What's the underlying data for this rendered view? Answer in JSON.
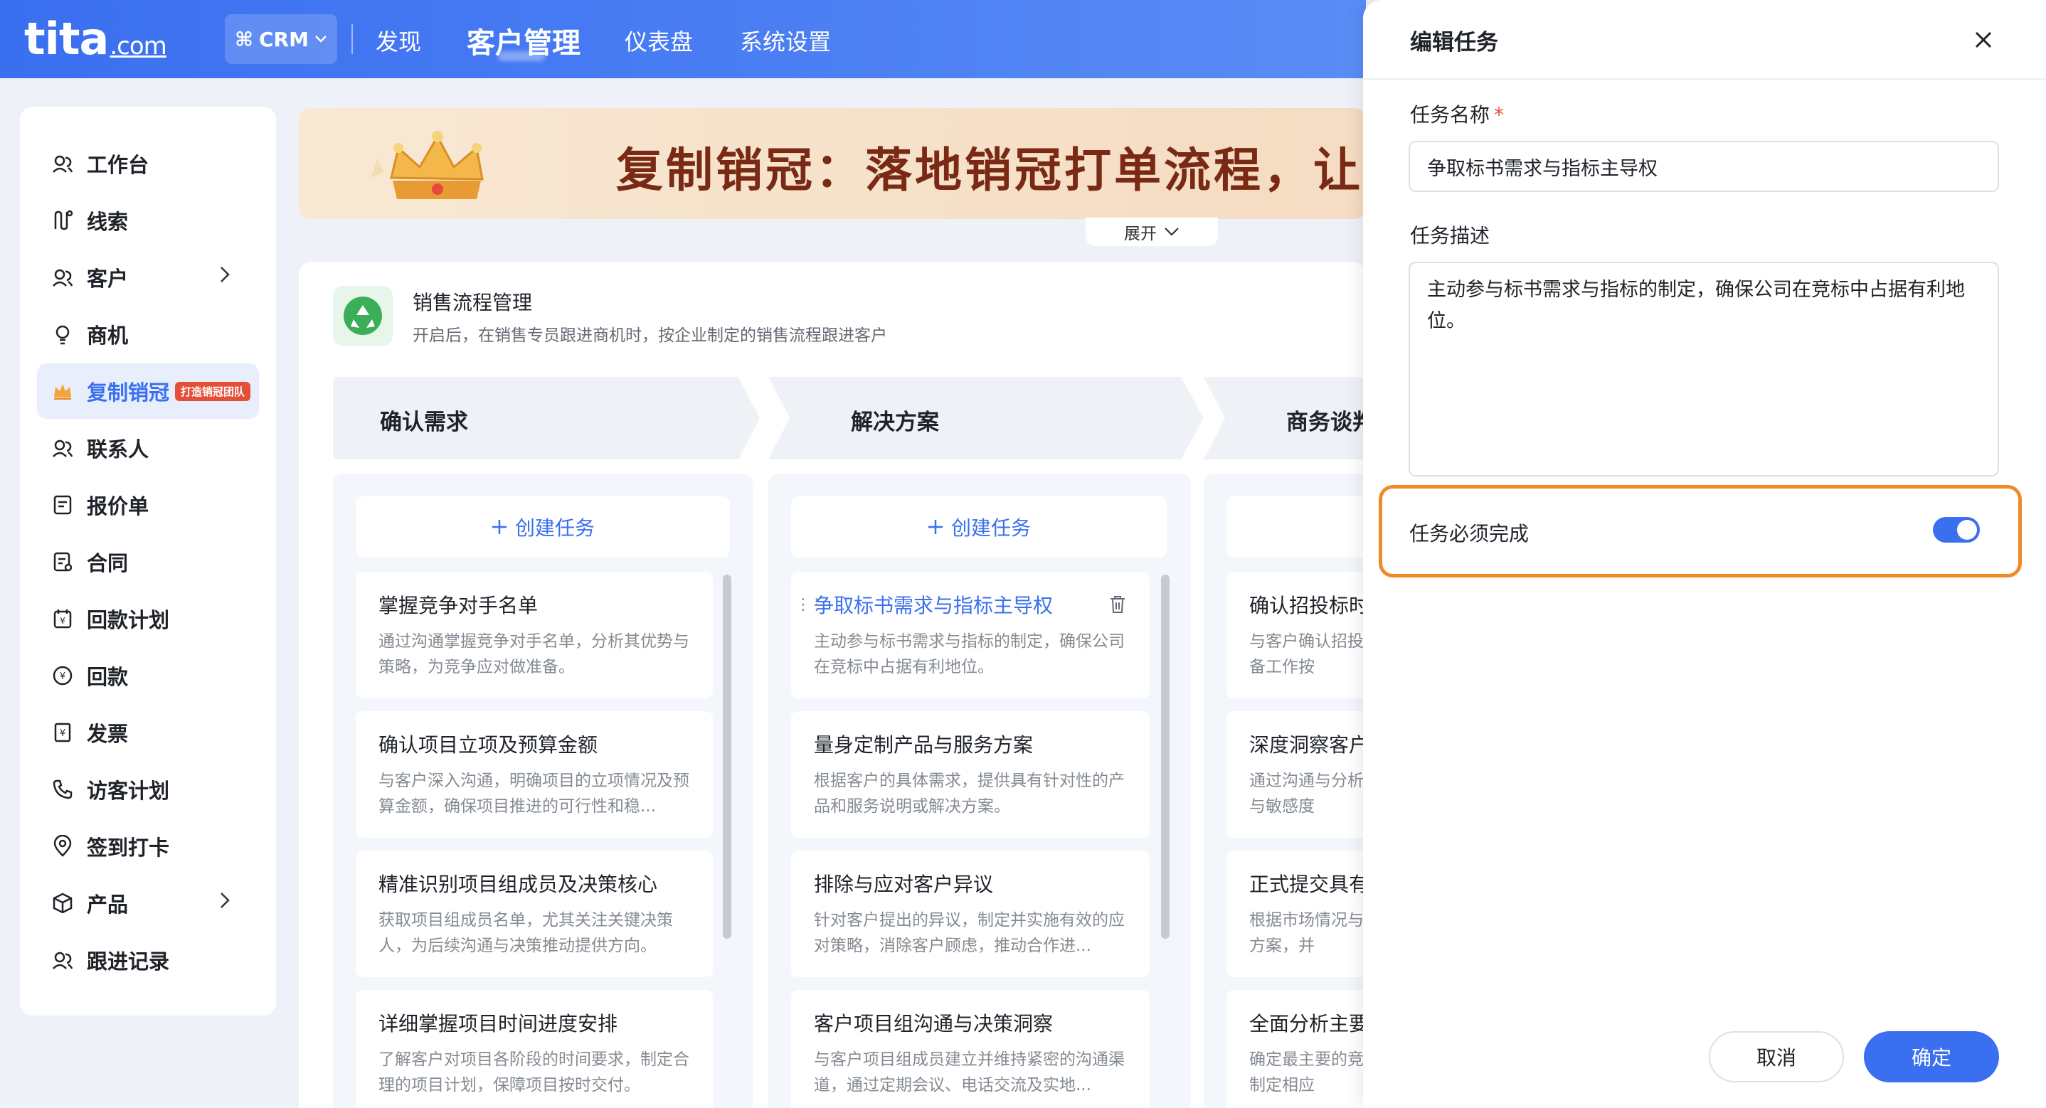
{
  "header": {
    "logo_main": "tita",
    "logo_suffix": ".com",
    "crm_label": "CRM",
    "nav": [
      "发现",
      "客户管理",
      "仪表盘",
      "系统设置"
    ],
    "active_nav": "客户管理"
  },
  "sidebar": {
    "items": [
      {
        "label": "工作台",
        "icon": "workbench-icon"
      },
      {
        "label": "线索",
        "icon": "leads-icon"
      },
      {
        "label": "客户",
        "icon": "customer-icon",
        "has_submenu": true
      },
      {
        "label": "商机",
        "icon": "opportunity-icon"
      },
      {
        "label": "复制销冠",
        "icon": "crown-icon",
        "badge": "打造销冠团队",
        "active": true
      },
      {
        "label": "联系人",
        "icon": "contacts-icon"
      },
      {
        "label": "报价单",
        "icon": "quote-icon"
      },
      {
        "label": "合同",
        "icon": "contract-icon"
      },
      {
        "label": "回款计划",
        "icon": "payment-plan-icon"
      },
      {
        "label": "回款",
        "icon": "payment-icon"
      },
      {
        "label": "发票",
        "icon": "invoice-icon"
      },
      {
        "label": "访客计划",
        "icon": "visit-plan-icon"
      },
      {
        "label": "签到打卡",
        "icon": "checkin-icon"
      },
      {
        "label": "产品",
        "icon": "product-icon",
        "has_submenu": true
      },
      {
        "label": "跟进记录",
        "icon": "followup-icon"
      }
    ]
  },
  "banner": {
    "title": "复制销冠：落地销冠打单流程，让全",
    "expand_label": "展开"
  },
  "process": {
    "title": "销售流程管理",
    "description": "开启后，在销售专员跟进商机时，按企业制定的销售流程跟进客户",
    "create_task_label": "创建任务",
    "stages": [
      {
        "name": "确认需求",
        "tasks": [
          {
            "title": "掌握竞争对手名单",
            "desc": "通过沟通掌握竞争对手名单，分析其优势与策略，为竞争应对做准备。"
          },
          {
            "title": "确认项目立项及预算金额",
            "desc": "与客户深入沟通，明确项目的立项情况及预算金额，确保项目推进的可行性和稳..."
          },
          {
            "title": "精准识别项目组成员及决策核心",
            "desc": "获取项目组成员名单，尤其关注关键决策人，为后续沟通与决策推动提供方向。"
          },
          {
            "title": "详细掌握项目时间进度安排",
            "desc": "了解客户对项目各阶段的时间要求，制定合理的项目计划，保障项目按时交付。"
          }
        ]
      },
      {
        "name": "解决方案",
        "tasks": [
          {
            "title": "争取标书需求与指标主导权",
            "desc": "主动参与标书需求与指标的制定，确保公司在竞标中占据有利地位。"
          },
          {
            "title": "量身定制产品与服务方案",
            "desc": "根据客户的具体需求，提供具有针对性的产品和服务说明或解决方案。"
          },
          {
            "title": "排除与应对客户异议",
            "desc": "针对客户提出的异议，制定并实施有效的应对策略，消除客户顾虑，推动合作进..."
          },
          {
            "title": "客户项目组沟通与决策洞察",
            "desc": "与客户项目组成员建立并维持紧密的沟通渠道，通过定期会议、电话交流及实地..."
          }
        ]
      },
      {
        "name": "商务谈判",
        "tasks": [
          {
            "title": "确认招投标时",
            "desc": "与客户确认招投各项准备工作按"
          },
          {
            "title": "深度洞察客户",
            "desc": "通过沟通与分析关注点与敏感度"
          },
          {
            "title": "正式提交具有",
            "desc": "根据市场情况与务报价方案，并"
          },
          {
            "title": "全面分析主要",
            "desc": "确定最主要的竞策略，制定相应"
          }
        ]
      }
    ]
  },
  "drawer": {
    "title": "编辑任务",
    "name_label": "任务名称",
    "required_mark": "*",
    "name_value": "争取标书需求与指标主导权",
    "desc_label": "任务描述",
    "desc_value": "主动参与标书需求与指标的制定，确保公司在竞标中占据有利地位。",
    "must_complete_label": "任务必须完成",
    "must_complete_on": true,
    "cancel_label": "取消",
    "confirm_label": "确定"
  },
  "colors": {
    "primary": "#3a6ff0",
    "highlight_border": "#ef8a25",
    "badge": "#e54f38"
  }
}
